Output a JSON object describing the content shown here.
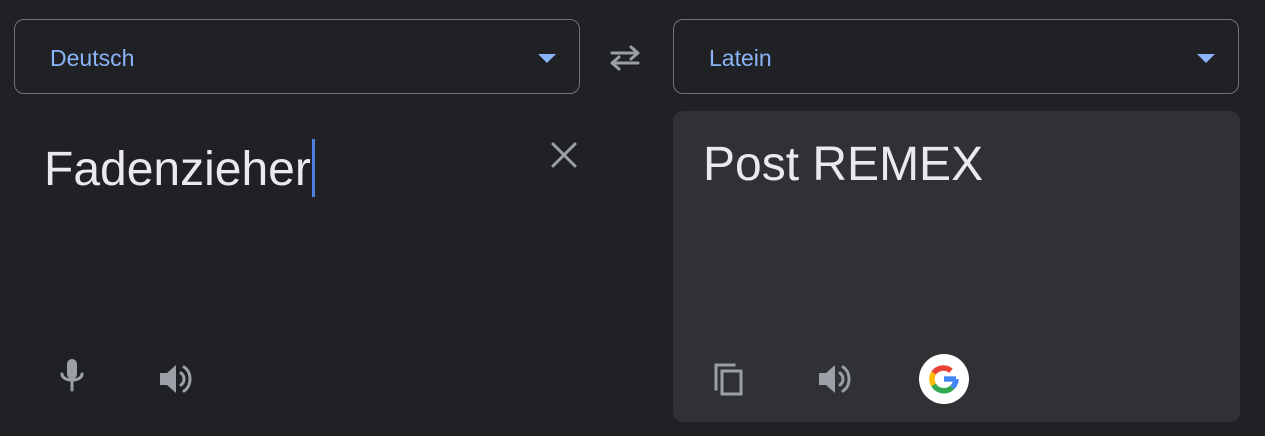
{
  "source_panel": {
    "language": "Deutsch",
    "text": "Fadenzieher"
  },
  "target_panel": {
    "language": "Latein",
    "text": "Post REMEX"
  },
  "icons": {
    "swap": "swap-languages-icon",
    "clear": "close-icon",
    "mic": "microphone-icon",
    "listen_source": "speaker-icon",
    "copy": "copy-icon",
    "listen_target": "speaker-icon",
    "google": "google-logo-icon"
  },
  "colors": {
    "background": "#202124",
    "target_panel_bg": "#303134",
    "accent": "#8ab4f8",
    "text": "#e8eaed",
    "icon": "#9aa0a6",
    "cursor": "#4f7fe0"
  }
}
